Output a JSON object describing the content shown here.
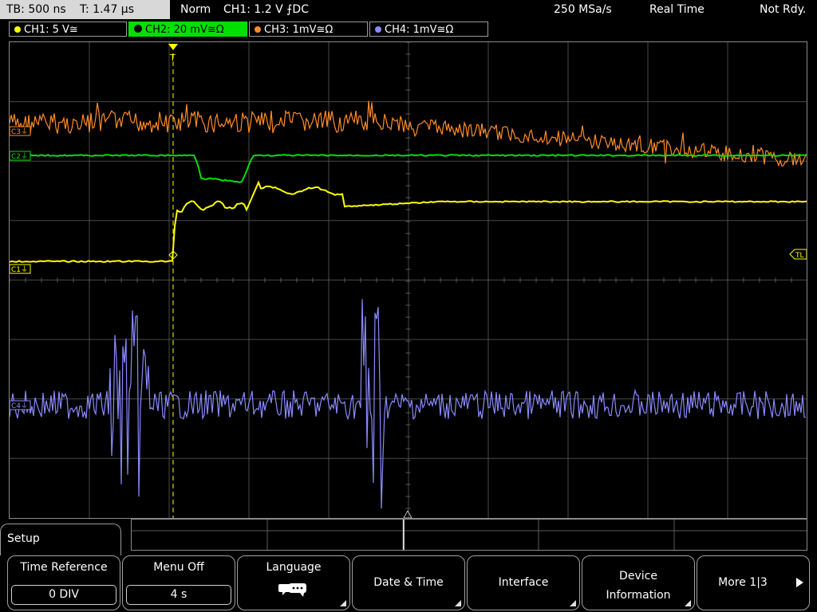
{
  "status": {
    "timebase": "TB: 500 ns",
    "trigger_time": "T: 1.47 µs",
    "mode": "Norm",
    "trigger": "CH1: 1.2 V ⨍DC",
    "sample_rate": "250 MSa/s",
    "acq_mode": "Real Time",
    "state": "Not Rdy."
  },
  "channels": [
    {
      "label": "CH1: 5 V≅",
      "color": "#ffff00"
    },
    {
      "label": "CH2: 20 mV≅Ω",
      "color": "#00e000",
      "active": true
    },
    {
      "label": "CH3: 1mV≅Ω",
      "color": "#ff8c28"
    },
    {
      "label": "CH4: 1mV≅Ω",
      "color": "#8a8aff"
    }
  ],
  "markers": {
    "c1": "C1⏚",
    "c2": "C2⏚",
    "c3": "C3⏚",
    "c4": "C4⏚",
    "trigger_level": "TL",
    "trigger_pos": "T"
  },
  "colors": {
    "ch1": "#ffff00",
    "ch2": "#00e000",
    "ch3": "#ff8c28",
    "ch4": "#8a8aff",
    "grid": "#5a5a5a"
  },
  "menu": {
    "title": "Setup",
    "softkeys": [
      {
        "title": "Time Reference",
        "value": "0 DIV"
      },
      {
        "title": "Menu Off",
        "value": "4 s"
      },
      {
        "title": "Language",
        "icon": "speech-bubbles-icon"
      },
      {
        "title": "Date & Time"
      },
      {
        "title": "Interface"
      },
      {
        "title": "Device Information"
      },
      {
        "title": "More 1|3",
        "icon": "right-arrow-icon"
      }
    ]
  }
}
